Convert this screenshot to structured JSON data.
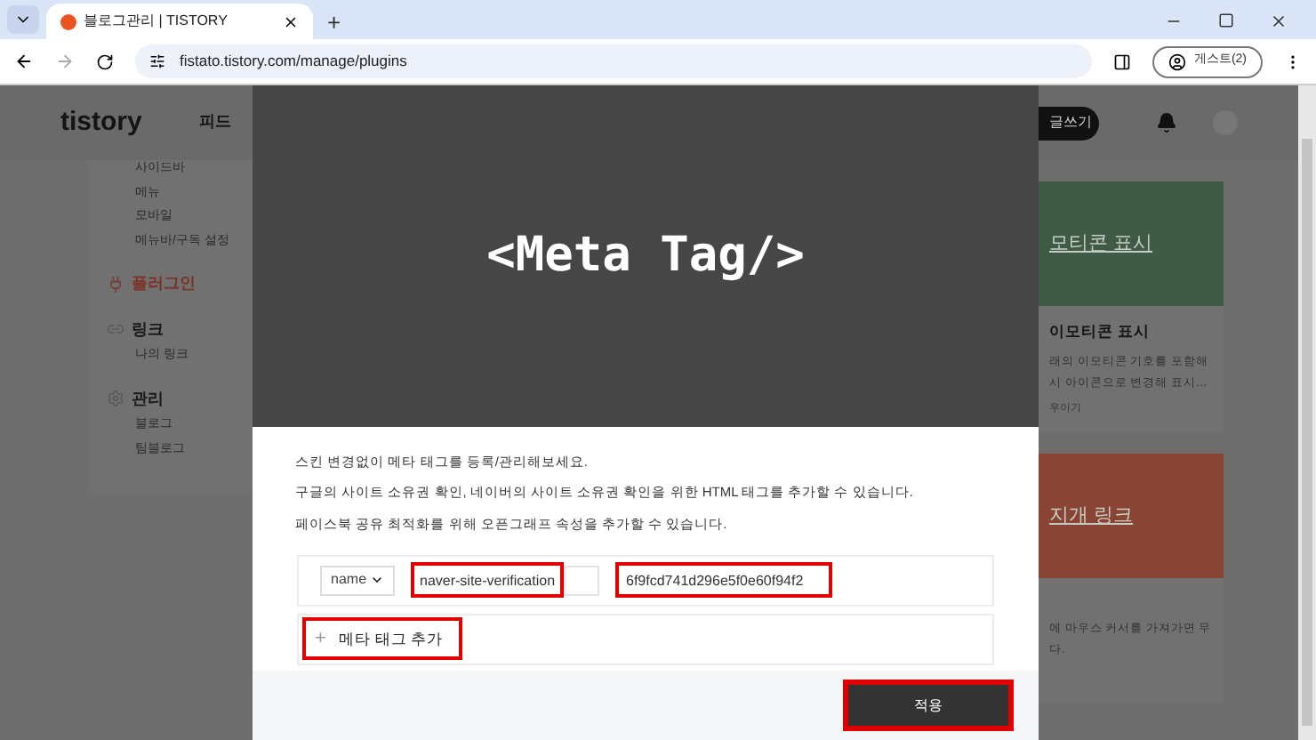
{
  "browser": {
    "tab_title": "블로그관리 | TISTORY",
    "new_tab": "+",
    "url": "fistato.tistory.com/manage/plugins",
    "profile": "게스트(2)"
  },
  "site_header": {
    "logo": "tistory",
    "nav": [
      "피드"
    ],
    "write_button": "글쓰기"
  },
  "sidebar": {
    "groups": [
      {
        "selected": false,
        "items": [
          "사이드바",
          "메뉴",
          "모바일",
          "메뉴바/구독 설정"
        ]
      },
      {
        "title": "플러그인",
        "selected": true
      },
      {
        "title": "링크",
        "selected": false,
        "items": [
          "나의 링크"
        ]
      },
      {
        "title": "관리",
        "selected": false,
        "items": [
          "블로그",
          "팀블로그"
        ]
      }
    ]
  },
  "cards": [
    {
      "banner": "모티콘 표시",
      "color": "#3f5a45",
      "title": "이모티콘 표시",
      "lines": [
        "래의 이모티콘 기호를 포함해",
        "시 아이콘으로 변경해 표시…"
      ],
      "meta": "우이기"
    },
    {
      "banner": "지개 링크",
      "color": "#8a4434",
      "lines": [
        "에 마우스 커서를 가져가면 무",
        "다."
      ]
    }
  ],
  "modal": {
    "banner": "<Meta Tag/>",
    "description": [
      "스킨 변경없이 메타 태그를 등록/관리해보세요.",
      "구글의 사이트 소유권 확인, 네이버의 사이트 소유권 확인을 위한 HTML 태그를 추가할 수 있습니다.",
      "페이스북 공유 최적화를 위해 오픈그래프 속성을 추가할 수 있습니다."
    ],
    "tags": [
      {
        "attribute": "name",
        "name_value": "naver-site-verification",
        "content": "6f9fcd741d296e5f0e60f94f2",
        "highlighted": true
      }
    ],
    "add_button": {
      "label": "메타 태그 추가",
      "icon": "+",
      "highlighted": true
    },
    "apply_button": {
      "label": "적용",
      "highlighted": true
    }
  }
}
